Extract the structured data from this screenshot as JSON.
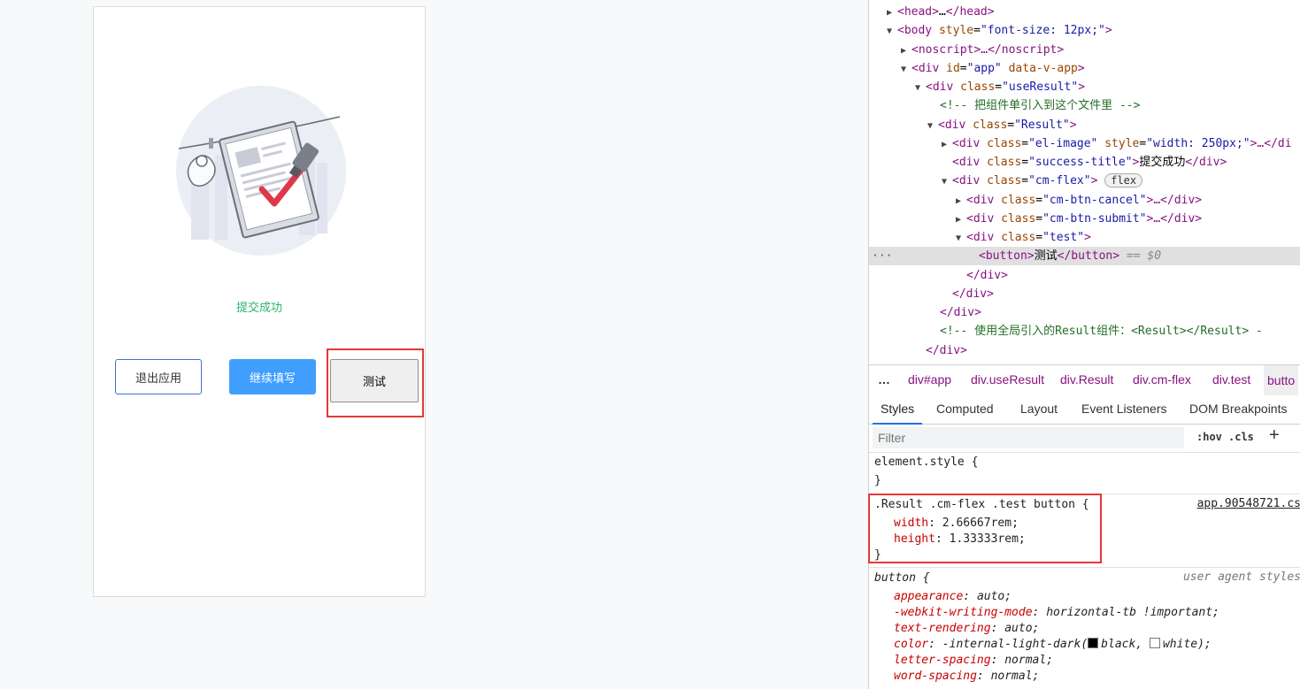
{
  "preview": {
    "success_title": "提交成功",
    "cancel_label": "退出应用",
    "submit_label": "继续填写",
    "test_label": "测试"
  },
  "dom_tree": {
    "line1": [
      "<head>",
      "…",
      "</head>"
    ],
    "line2_tag": "<body ",
    "line2_attr": "style",
    "line2_val": "\"font-size: 12px;\"",
    "line3": "<noscript>…</noscript>",
    "line4_attr": "id",
    "line4_val": "\"app\"",
    "line4_attr2": "data-v-app",
    "line5_val": "\"useResult\"",
    "comment1": "<!-- 把组件单引入到这个文件里 -->",
    "line7_val": "\"Result\"",
    "line8_val": "\"el-image\"",
    "line8_attr2": "style",
    "line8_val2": "\"width: 250px;\"",
    "line8_rest": ">…</di",
    "line9_val": "\"success-title\"",
    "line9_text": "提交成功",
    "line10_val": "\"cm-flex\"",
    "flex_badge": "flex",
    "line11_val": "\"cm-btn-cancel\"",
    "line12_val": "\"cm-btn-submit\"",
    "line13_val": "\"test\"",
    "selected_text": "测试",
    "selected_eq": "== $0",
    "comment2": "<!-- 使用全局引入的Result组件：<Result></Result> -"
  },
  "breadcrumbs": [
    "…",
    "div#app",
    "div.useResult",
    "div.Result",
    "div.cm-flex",
    "div.test",
    "butto"
  ],
  "tabs": [
    "Styles",
    "Computed",
    "Layout",
    "Event Listeners",
    "DOM Breakpoints"
  ],
  "filter": {
    "placeholder": "Filter",
    "hov": ":hov",
    "cls": ".cls",
    "plus": "+"
  },
  "styles": {
    "element_style": "element.style {",
    "close": "}",
    "rule_selector": ".Result .cm-flex .test button {",
    "rule_source": "app.90548721.cs",
    "width_prop": "width",
    "width_val": "2.66667rem;",
    "height_prop": "height",
    "height_val": "1.33333rem;",
    "ua_selector": "button {",
    "ua_source": "user agent styles",
    "ua_props": [
      {
        "prop": "appearance",
        "val": "auto;"
      },
      {
        "prop": "-webkit-writing-mode",
        "val": "horizontal-tb !important;"
      },
      {
        "prop": "text-rendering",
        "val": "auto;"
      },
      {
        "prop": "color",
        "val": "-internal-light-dark("
      },
      {
        "prop": "letter-spacing",
        "val": "normal;"
      },
      {
        "prop": "word-spacing",
        "val": "normal;"
      }
    ],
    "color_black": "black,",
    "color_white": "white);"
  },
  "colors": {
    "success_green": "#2db46c",
    "submit_blue": "#409eff",
    "highlight_red": "#e53935",
    "devtools_tab_blue": "#1a73e8"
  }
}
